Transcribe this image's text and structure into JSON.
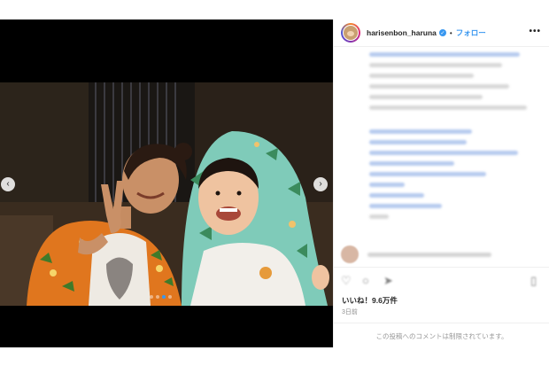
{
  "post": {
    "username": "harisenbon_haruna",
    "separator": "•",
    "follow_label": "フォロー",
    "more_label": "•••",
    "verified_symbol": "✓",
    "likes": "いいね！9.6万件",
    "time_ago": "3日前",
    "comments_restricted": "この投稿へのコメントは制限されています。"
  },
  "media": {
    "prev_symbol": "‹",
    "next_symbol": "›",
    "slide_count": 4,
    "active_slide": 3
  },
  "icons": {
    "like": "heart-icon",
    "comment": "comment-icon",
    "share": "share-icon",
    "save": "bookmark-icon"
  },
  "colors": {
    "accent": "#3897f0",
    "text": "#262626",
    "muted": "#8e8e8e",
    "media_bg": "#000000"
  }
}
